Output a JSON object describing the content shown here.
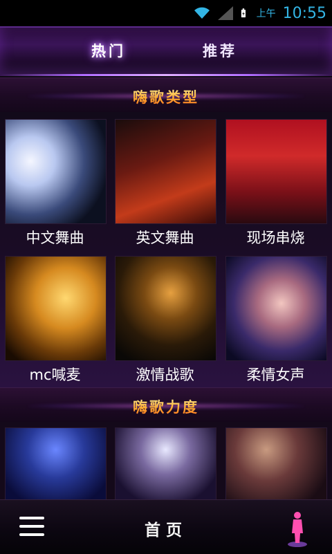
{
  "status_bar": {
    "ampm": "上午",
    "time": "10:55",
    "icons": [
      "wifi-icon",
      "signal-icon",
      "battery-charging-icon"
    ],
    "accent_color": "#33b5e5"
  },
  "top_tabs": [
    {
      "label": "热门",
      "selected": true
    },
    {
      "label": "推荐",
      "selected": false
    }
  ],
  "sections": [
    {
      "title": "嗨歌类型",
      "items": [
        {
          "label": "中文舞曲"
        },
        {
          "label": "英文舞曲"
        },
        {
          "label": "现场串烧"
        },
        {
          "label": "mc喊麦"
        },
        {
          "label": "激情战歌"
        },
        {
          "label": "柔情女声"
        }
      ]
    },
    {
      "title": "嗨歌力度",
      "items": [
        {
          "label": ""
        },
        {
          "label": ""
        },
        {
          "label": ""
        }
      ]
    }
  ],
  "bottom_bar": {
    "menu_icon": "menu-icon",
    "title": "首页",
    "right_icon": "figure-icon"
  },
  "colors": {
    "background": "#0e0812",
    "accent_purple": "#b06cff",
    "section_title_gradient": [
      "#fff3a0",
      "#ffb030",
      "#ff6a20"
    ]
  }
}
